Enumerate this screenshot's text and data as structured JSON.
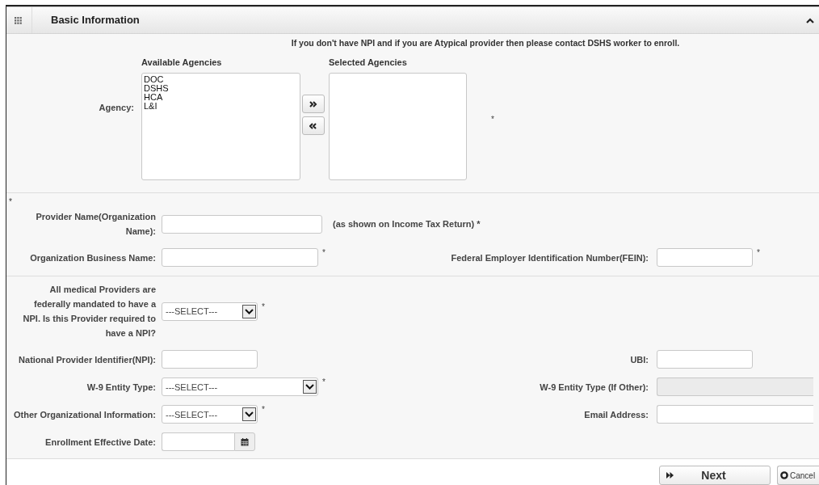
{
  "header": {
    "title": "Basic Information",
    "expanded": true
  },
  "notice": "If you don't have NPI and if you are Atypical provider then please contact DSHS worker to enroll.",
  "agency": {
    "label": "Agency:",
    "available_heading": "Available Agencies",
    "selected_heading": "Selected Agencies",
    "available": [
      "DOC",
      "DSHS",
      "HCA",
      "L&I"
    ],
    "required_mark": "*"
  },
  "section_mark": "*",
  "organization": {
    "provider_name": {
      "label": "Provider Name(Organization Name):",
      "note": "(as shown on Income Tax Return) *"
    },
    "business_name": {
      "label": "Organization Business Name:",
      "required_mark": "*"
    },
    "fein": {
      "label": "Federal Employer Identification Number(FEIN):",
      "required_mark": "*"
    }
  },
  "details": {
    "npi_required": {
      "label": "All medical Providers are federally mandated to have a NPI. Is this Provider required to have a NPI?",
      "value": "---SELECT---",
      "required_mark": "*"
    },
    "npi": {
      "label": "National Provider Identifier(NPI):"
    },
    "ubi": {
      "label": "UBI:"
    },
    "w9_type": {
      "label": "W-9 Entity Type:",
      "value": "---SELECT---",
      "required_mark": "*"
    },
    "w9_other": {
      "label": "W-9 Entity Type (If Other):",
      "disabled": true
    },
    "other_info": {
      "label": "Other Organizational Information:",
      "value": "---SELECT---",
      "required_mark": "*"
    },
    "email": {
      "label": "Email Address:"
    },
    "effective_date": {
      "label": "Enrollment Effective Date:"
    }
  },
  "footer": {
    "next": "Next",
    "cancel": "Cancel"
  }
}
